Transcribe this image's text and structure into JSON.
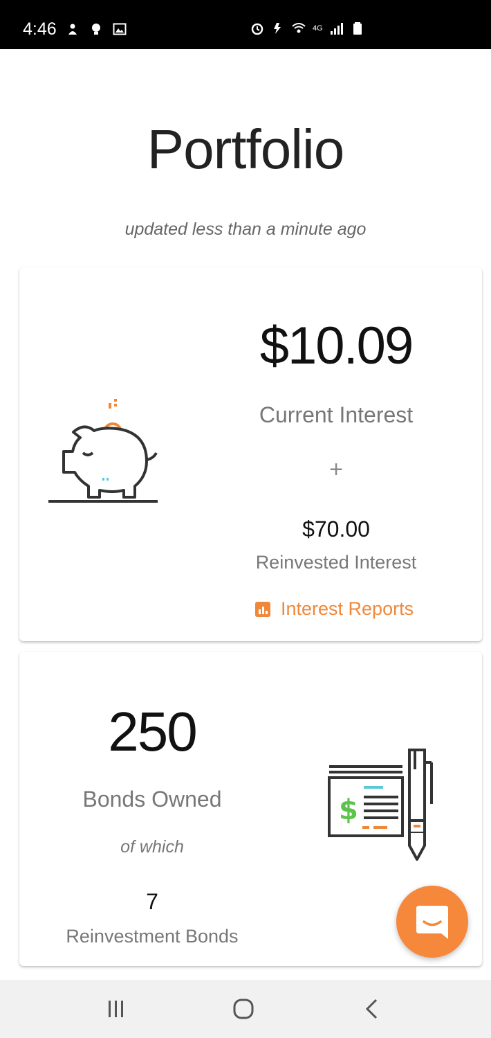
{
  "status_bar": {
    "time": "4:46",
    "network_label": "4G"
  },
  "header": {
    "title": "Portfolio",
    "subtitle": "updated less than a minute ago"
  },
  "interest_card": {
    "current_interest_amount": "$10.09",
    "current_interest_label": "Current Interest",
    "plus_sign": "+",
    "reinvested_amount": "$70.00",
    "reinvested_label": "Reinvested Interest",
    "reports_link_label": "Interest Reports",
    "illustration_icon": "piggy-bank-icon"
  },
  "bonds_card": {
    "bonds_count": "250",
    "bonds_label": "Bonds Owned",
    "of_which_label": "of which",
    "reinvestment_count": "7",
    "reinvestment_label": "Reinvestment Bonds",
    "illustration_icon": "cheque-pen-icon"
  },
  "chat_button": {
    "icon": "chat-icon"
  },
  "nav_bar": {
    "buttons": [
      "recents",
      "home",
      "back"
    ]
  },
  "colors": {
    "accent": "#f0883a",
    "icon_line": "#333333",
    "icon_teal": "#5bc7d8",
    "icon_green": "#5cc34c",
    "status_bar_bg": "#000000"
  }
}
